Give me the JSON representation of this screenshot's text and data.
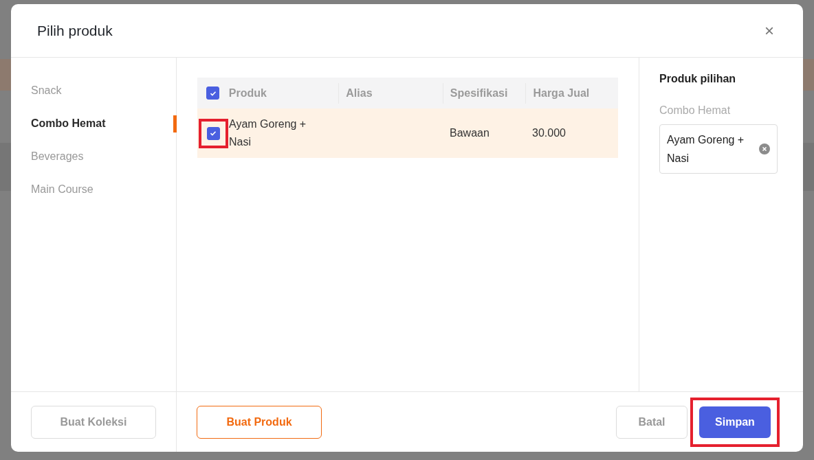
{
  "dialog": {
    "title": "Pilih produk",
    "close": "×",
    "categories": [
      {
        "label": "Snack",
        "selected": false
      },
      {
        "label": "Combo Hemat",
        "selected": true
      },
      {
        "label": "Beverages",
        "selected": false
      },
      {
        "label": "Main Course",
        "selected": false
      }
    ],
    "table": {
      "select_all_checked": true,
      "columns": [
        "Produk",
        "Alias",
        "Spesifikasi",
        "Harga Jual"
      ],
      "rows": [
        {
          "checked": true,
          "highlighted": true,
          "cells": [
            "Ayam Goreng + Nasi",
            "",
            "Bawaan",
            "30.000"
          ]
        }
      ]
    },
    "selection": {
      "title": "Produk pilihan",
      "group": "Combo Hemat",
      "items": [
        "Ayam Goreng + Nasi"
      ]
    },
    "buttons": {
      "collection": "Buat Koleksi",
      "product": "Buat Produk",
      "cancel": "Batal",
      "save": {
        "label": "Simpan",
        "highlighted": true
      }
    }
  }
}
